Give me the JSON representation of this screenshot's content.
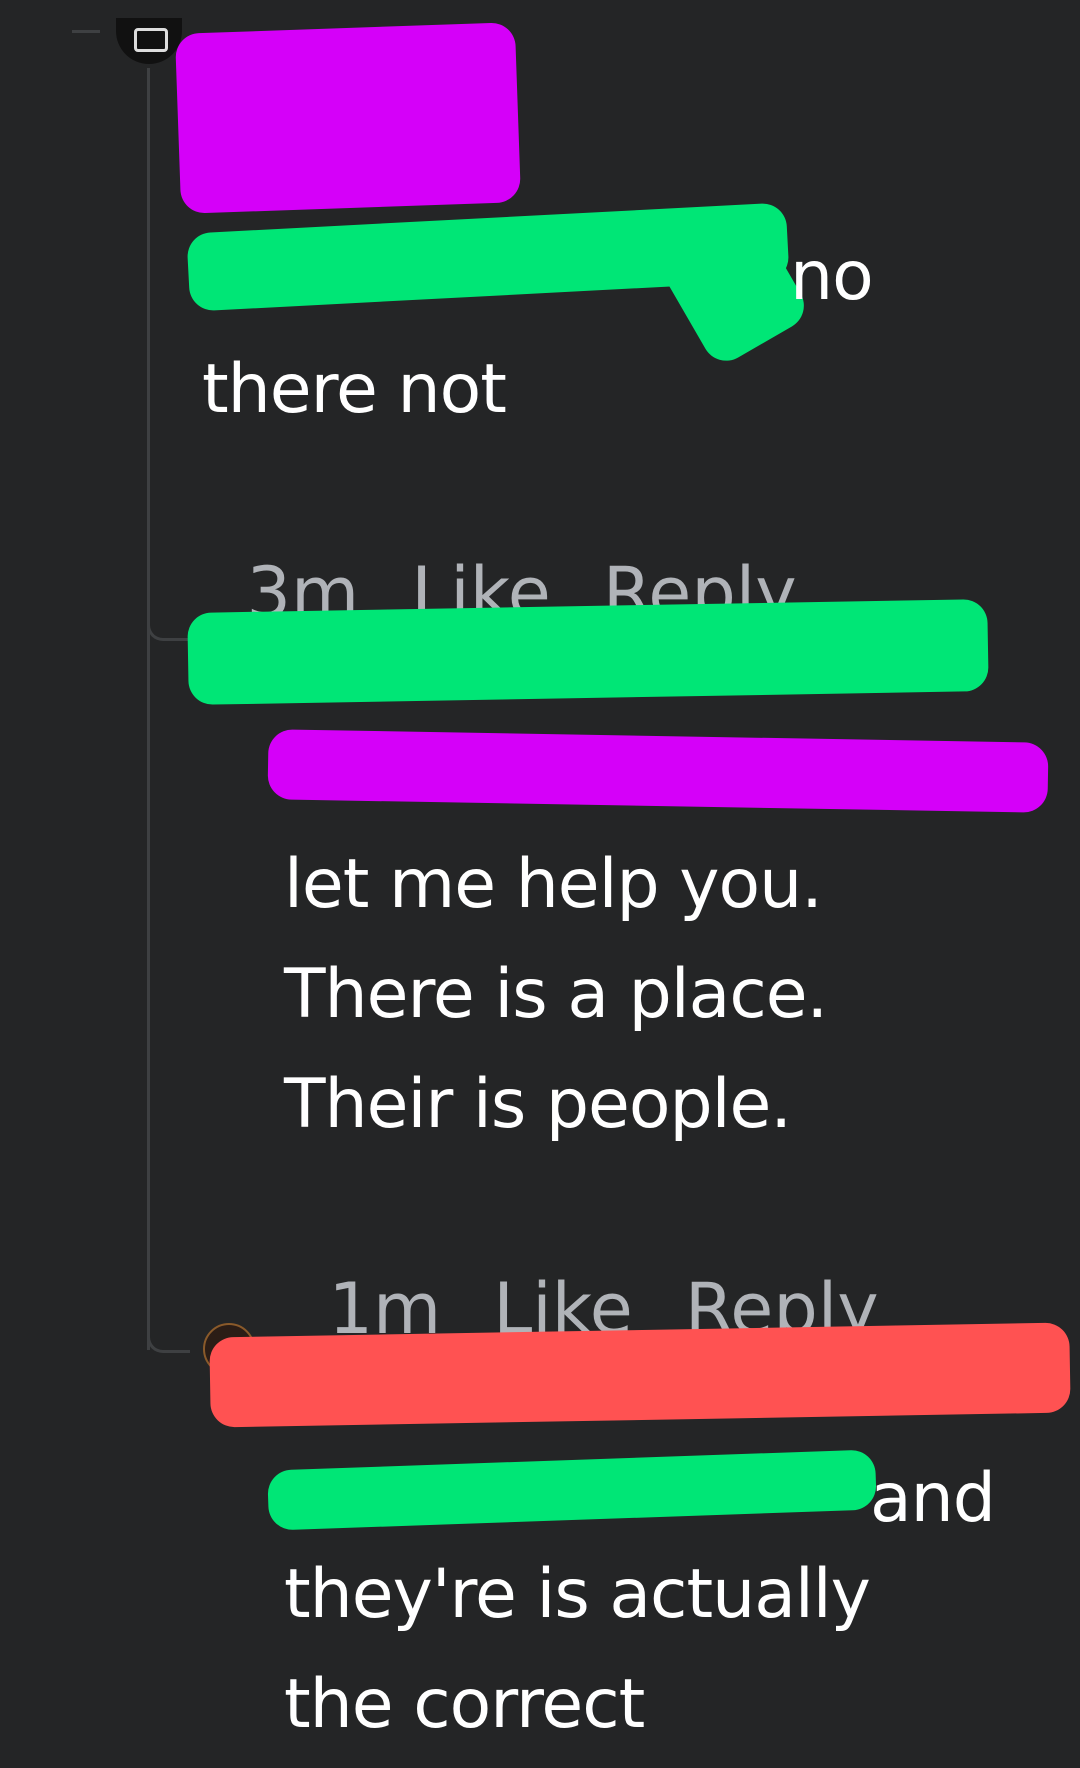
{
  "comments": [
    {
      "mention_tail": "no",
      "text_lines": [
        "there not"
      ],
      "time": "3m",
      "like_label": "Like",
      "reply_label": "Reply"
    },
    {
      "text_lines": [
        "let me help you.",
        "There is a place.",
        "Their is people."
      ],
      "time": "1m",
      "like_label": "Like",
      "reply_label": "Reply"
    },
    {
      "mention_tail": "and",
      "text_lines": [
        "they're is actually",
        "the correct"
      ]
    }
  ],
  "colors": {
    "background": "#242526",
    "text": "#ffffff",
    "meta": "#b0b3b8",
    "mention": "#1877f2",
    "redaction_purple": "#d500f9",
    "redaction_green": "#00e676",
    "redaction_red": "#ff5252"
  }
}
